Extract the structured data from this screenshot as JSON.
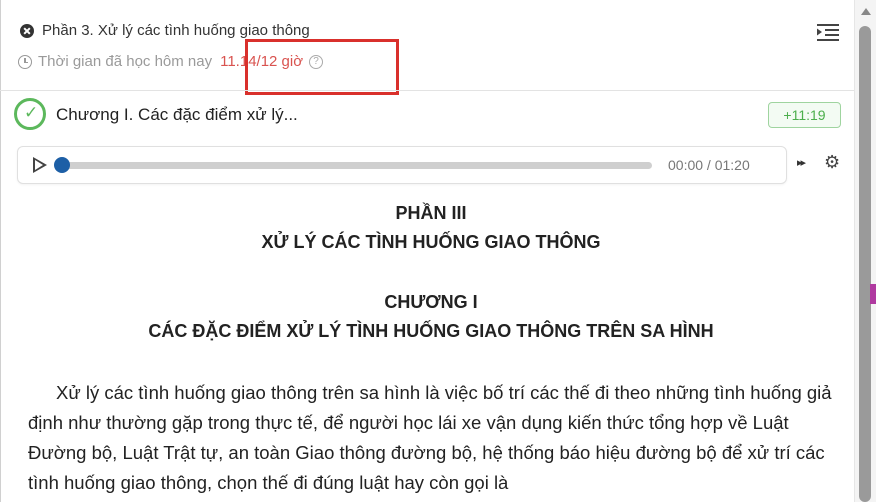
{
  "header": {
    "title": "Phần 3. Xử lý các tình huống giao thông",
    "time_label": "Thời gian đã học hôm nay",
    "time_value": "11.14/12 giờ",
    "help_glyph": "?"
  },
  "chapter": {
    "title": "Chương I. Các đặc điểm xử lý...",
    "duration_badge": "+11:19",
    "status": "completed"
  },
  "audio": {
    "current_time": "00:00 / 01:20",
    "progress": 0,
    "speed_glyph": "▸▸",
    "settings_glyph": "⚙"
  },
  "content": {
    "part_heading": "PHẦN III",
    "part_title": "XỬ LÝ CÁC TÌNH HUỐNG GIAO THÔNG",
    "chapter_heading": "CHƯƠNG I",
    "chapter_title": "CÁC ĐẶC ĐIỂM XỬ LÝ TÌNH HUỐNG GIAO THÔNG TRÊN SA HÌNH",
    "paragraph": "Xử lý các tình huống giao thông trên sa hình là việc bố trí các thế đi theo những tình huống giả định như thường gặp trong thực tế, để người học lái xe vận dụng kiến thức tổng hợp về Luật Đường bộ, Luật Trật tự, an toàn Giao thông đường bộ, hệ thống báo hiệu đường bộ để xử trí các tình huống giao thông, chọn thế đi đúng luật hay còn gọi là"
  },
  "colors": {
    "highlight_box": "#d9302c",
    "time_value": "#d9534f",
    "completed_green": "#5cb85c",
    "progress_knob": "#1d5fa6"
  },
  "icons": [
    "close-icon",
    "clock-icon",
    "help-icon",
    "menu-list-icon",
    "check-icon",
    "play-icon",
    "speed-icon",
    "gear-icon",
    "scroll-up-icon"
  ]
}
